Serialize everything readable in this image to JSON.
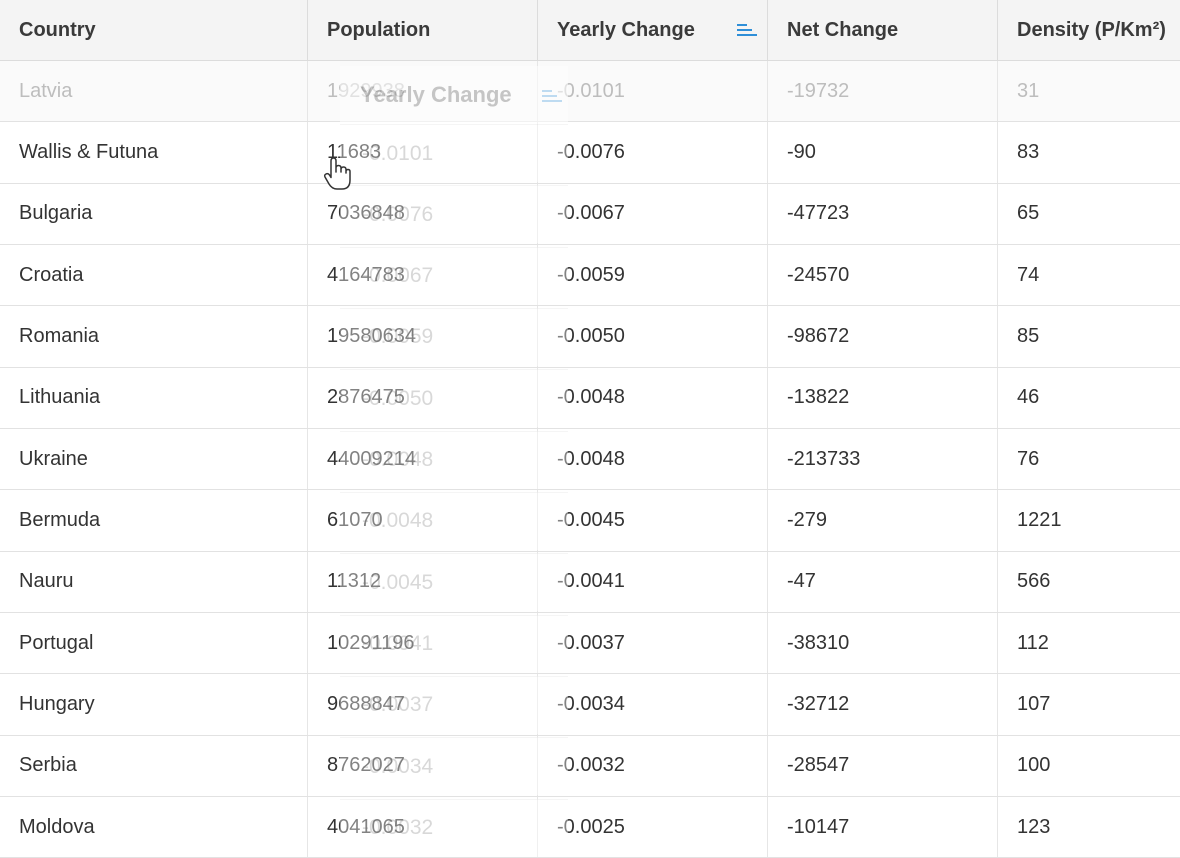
{
  "columns": [
    "Country",
    "Population",
    "Yearly Change",
    "Net Change",
    "Density (P/Km²)"
  ],
  "sort_icon": "sort-ascending-icon",
  "accent_color": "#2f8fd8",
  "rows": [
    {
      "country": "Latvia",
      "population": "1929938",
      "yearly": "-0.0101",
      "net": "-19732",
      "density": "31"
    },
    {
      "country": "Wallis & Futuna",
      "population": "11683",
      "yearly": "-0.0076",
      "net": "-90",
      "density": "83"
    },
    {
      "country": "Bulgaria",
      "population": "7036848",
      "yearly": "-0.0067",
      "net": "-47723",
      "density": "65"
    },
    {
      "country": "Croatia",
      "population": "4164783",
      "yearly": "-0.0059",
      "net": "-24570",
      "density": "74"
    },
    {
      "country": "Romania",
      "population": "19580634",
      "yearly": "-0.0050",
      "net": "-98672",
      "density": "85"
    },
    {
      "country": "Lithuania",
      "population": "2876475",
      "yearly": "-0.0048",
      "net": "-13822",
      "density": "46"
    },
    {
      "country": "Ukraine",
      "population": "44009214",
      "yearly": "-0.0048",
      "net": "-213733",
      "density": "76"
    },
    {
      "country": "Bermuda",
      "population": "61070",
      "yearly": "-0.0045",
      "net": "-279",
      "density": "1221"
    },
    {
      "country": "Nauru",
      "population": "11312",
      "yearly": "-0.0041",
      "net": "-47",
      "density": "566"
    },
    {
      "country": "Portugal",
      "population": "10291196",
      "yearly": "-0.0037",
      "net": "-38310",
      "density": "112"
    },
    {
      "country": "Hungary",
      "population": "9688847",
      "yearly": "-0.0034",
      "net": "-32712",
      "density": "107"
    },
    {
      "country": "Serbia",
      "population": "8762027",
      "yearly": "-0.0032",
      "net": "-28547",
      "density": "100"
    },
    {
      "country": "Moldova",
      "population": "4041065",
      "yearly": "-0.0025",
      "net": "-10147",
      "density": "123"
    }
  ],
  "drag_ghost": {
    "header": "Yearly Change",
    "values": [
      "-0.0101",
      "-0.0076",
      "-0.0067",
      "-0.0059",
      "-0.0050",
      "-0.0048",
      "-0.0048",
      "-0.0045",
      "-0.0041",
      "-0.0037",
      "-0.0034",
      "-0.0032"
    ]
  },
  "cursor_icon": "grab-hand-icon"
}
